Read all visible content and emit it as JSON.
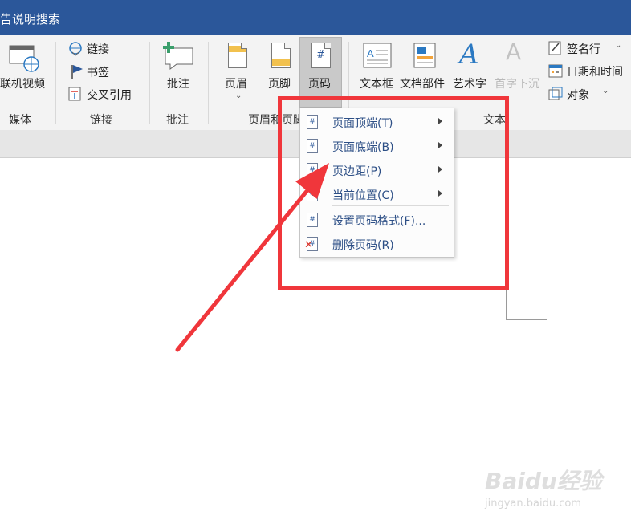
{
  "titlebar": {
    "title": "告说明搜索"
  },
  "ribbon": {
    "media": {
      "button_label": "联机视频",
      "group_label": "媒体"
    },
    "links": {
      "items": [
        {
          "label": "链接",
          "icon": "link-icon"
        },
        {
          "label": "书签",
          "icon": "bookmark-flag-icon"
        },
        {
          "label": "交叉引用",
          "icon": "cross-reference-icon"
        }
      ],
      "group_label": "链接"
    },
    "comments": {
      "button_label": "批注",
      "group_label": "批注"
    },
    "header_footer": {
      "header_label": "页眉",
      "footer_label": "页脚",
      "page_number_label": "页码",
      "group_label": "页眉和页脚"
    },
    "text": {
      "textbox_label": "文本框",
      "quickparts_label": "文档部件",
      "wordart_label": "艺术字",
      "dropcap_label": "首字下沉",
      "signature_label": "签名行",
      "datetime_label": "日期和时间",
      "object_label": "对象",
      "group_label": "文本"
    }
  },
  "page_number_menu": {
    "items": [
      {
        "label": "页面顶端(T)",
        "has_submenu": true
      },
      {
        "label": "页面底端(B)",
        "has_submenu": true
      },
      {
        "label": "页边距(P)",
        "has_submenu": true
      },
      {
        "label": "当前位置(C)",
        "has_submenu": true
      },
      {
        "label": "设置页码格式(F)...",
        "has_submenu": false
      },
      {
        "label": "删除页码(R)",
        "has_submenu": false
      }
    ]
  },
  "annotation": {
    "box_color": "#f0363b",
    "arrow_color": "#f0363b"
  },
  "watermark": {
    "text": "Baidu经验",
    "sub": "jingyan.baidu.com"
  },
  "colors": {
    "title_bar": "#2b579a",
    "ribbon_bg": "#f3f3f3",
    "menu_text": "#2d4f86"
  }
}
